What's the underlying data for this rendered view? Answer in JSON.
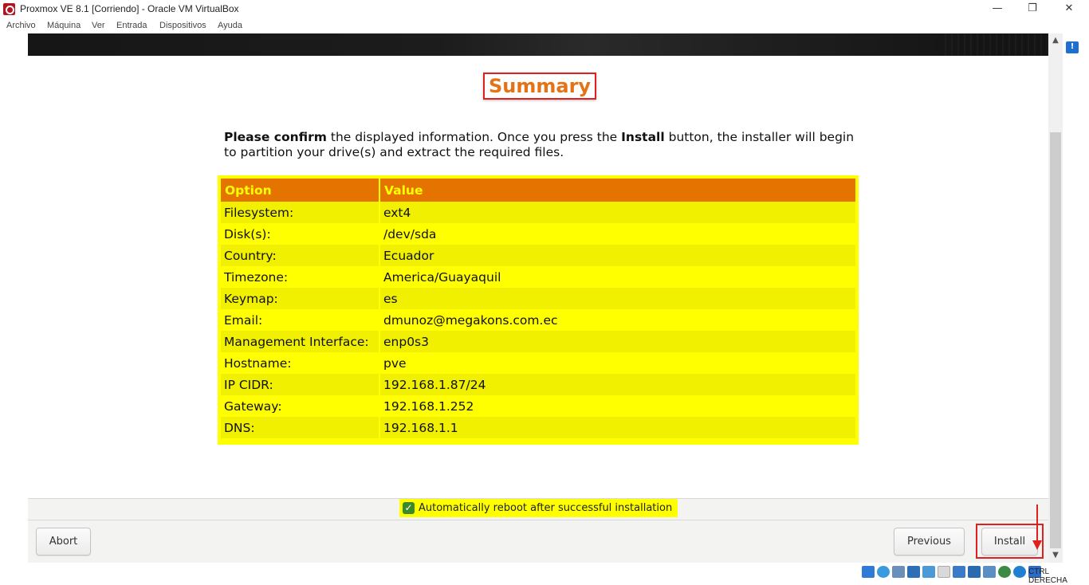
{
  "window": {
    "title": "Proxmox VE 8.1 [Corriendo] - Oracle VM VirtualBox",
    "minimize_glyph": "—",
    "restore_glyph": "❐",
    "close_glyph": "✕"
  },
  "menubar": {
    "items": [
      "Archivo",
      "Máquina",
      "Ver",
      "Entrada",
      "Dispositivos",
      "Ayuda"
    ]
  },
  "installer": {
    "heading": "Summary",
    "intro": {
      "strong1": "Please confirm",
      "text1": " the displayed information. Once you press the ",
      "strong2": "Install",
      "text2": " button, the installer will begin to partition your drive(s) and extract the required files."
    },
    "table": {
      "headers": {
        "option": "Option",
        "value": "Value"
      },
      "rows": [
        {
          "option": "Filesystem:",
          "value": "ext4"
        },
        {
          "option": "Disk(s):",
          "value": "/dev/sda"
        },
        {
          "option": "Country:",
          "value": "Ecuador"
        },
        {
          "option": "Timezone:",
          "value": "America/Guayaquil"
        },
        {
          "option": "Keymap:",
          "value": "es"
        },
        {
          "option": "Email:",
          "value": "dmunoz@megakons.com.ec"
        },
        {
          "option": "Management Interface:",
          "value": "enp0s3"
        },
        {
          "option": "Hostname:",
          "value": "pve"
        },
        {
          "option": "IP CIDR:",
          "value": "192.168.1.87/24"
        },
        {
          "option": "Gateway:",
          "value": "192.168.1.252"
        },
        {
          "option": "DNS:",
          "value": "192.168.1.1"
        }
      ]
    },
    "reboot_checkbox": {
      "label": "Automatically reboot after successful installation",
      "checked": true,
      "check_glyph": "✓"
    },
    "buttons": {
      "abort": "Abort",
      "previous": "Previous",
      "install": "Install"
    }
  },
  "statusbar": {
    "host_key": "CTRL DERECHA",
    "icons": [
      "hdd-icon",
      "optical-disk-icon",
      "audio-icon",
      "network-icon",
      "usb-icon",
      "shared-folder-icon",
      "display-icon",
      "recording-icon",
      "capture-icon",
      "cpu-icon",
      "mouse-integration-icon",
      "keyboard-icon"
    ]
  },
  "colors": {
    "accent_orange": "#e57300",
    "highlight_yellow": "#ffff00",
    "annotation_red": "#e02020",
    "checkbox_green": "#3a8a2a"
  }
}
